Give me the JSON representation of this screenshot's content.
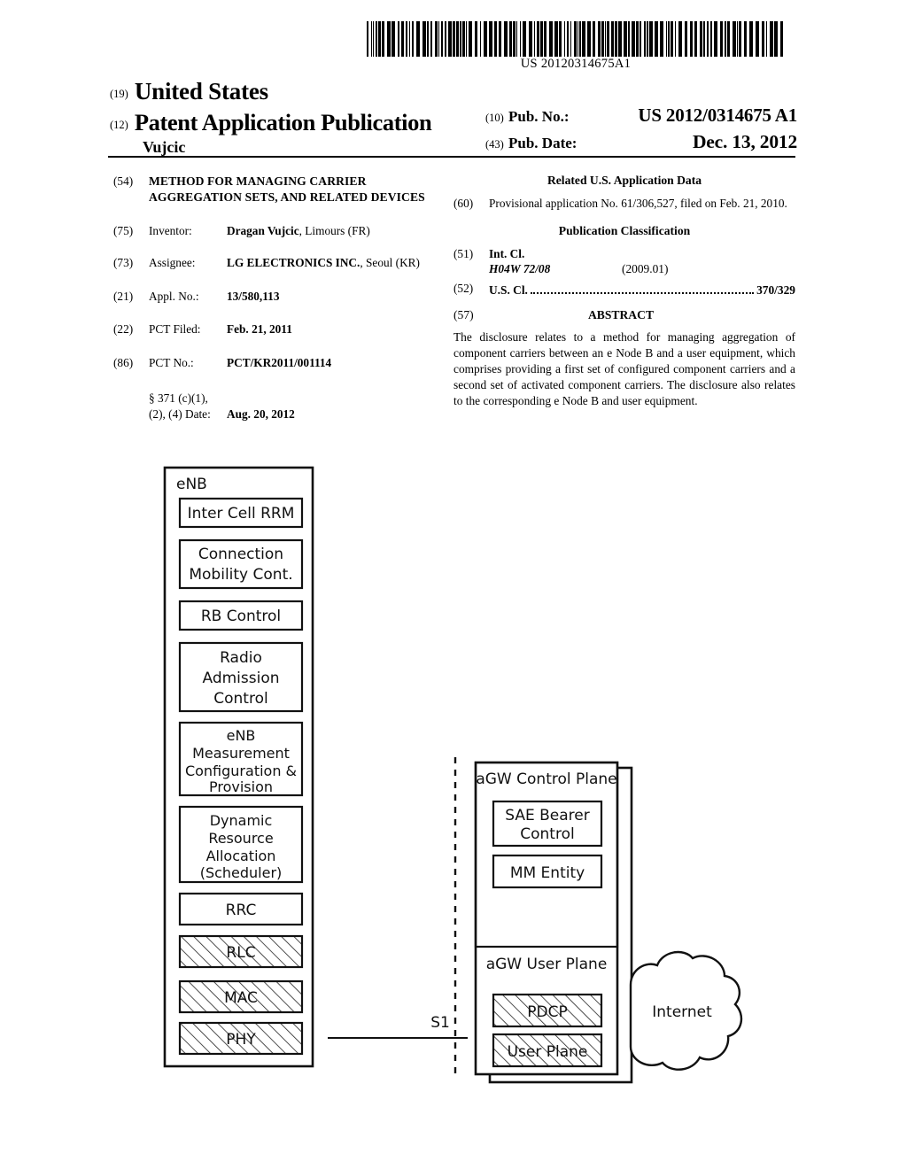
{
  "header": {
    "barcode_number": "US 20120314675A1",
    "tag_19": "(19)",
    "country": "United States",
    "tag_12": "(12)",
    "doc_type": "Patent Application Publication",
    "inventor_surname": "Vujcic",
    "tag_10": "(10)",
    "pub_no_label": "Pub. No.:",
    "pub_no_value": "US 2012/0314675 A1",
    "tag_43": "(43)",
    "pub_date_label": "Pub. Date:",
    "pub_date_value": "Dec. 13, 2012"
  },
  "left_column": {
    "title_tag": "(54)",
    "title": "METHOD FOR MANAGING CARRIER AGGREGATION SETS, AND RELATED DEVICES",
    "rows": [
      {
        "tag": "(75)",
        "label": "Inventor:",
        "bold_part": "Dragan Vujcic",
        "rest": ", Limours (FR)"
      },
      {
        "tag": "(73)",
        "label": "Assignee:",
        "bold_part": "LG ELECTRONICS INC.",
        "rest": ", Seoul (KR)"
      },
      {
        "tag": "(21)",
        "label": "Appl. No.:",
        "bold_part": "13/580,113",
        "rest": ""
      },
      {
        "tag": "(22)",
        "label": "PCT Filed:",
        "bold_part": "Feb. 21, 2011",
        "rest": ""
      },
      {
        "tag": "(86)",
        "label": "PCT No.:",
        "bold_part": "PCT/KR2011/001114",
        "rest": ""
      }
    ],
    "section371_line1": "§ 371 (c)(1),",
    "section371_line2": "(2), (4) Date:",
    "section371_date": "Aug. 20, 2012"
  },
  "right_column": {
    "related_head": "Related U.S. Application Data",
    "related_tag": "(60)",
    "related_text": "Provisional application No. 61/306,527, filed on Feb. 21, 2010.",
    "classification_head": "Publication Classification",
    "intcl_tag": "(51)",
    "intcl_label": "Int. Cl.",
    "intcl_code": "H04W 72/08",
    "intcl_version": "(2009.01)",
    "uscl_tag": "(52)",
    "uscl_label": "U.S. Cl.",
    "uscl_value": "370/329",
    "abstract_tag": "(57)",
    "abstract_head": "ABSTRACT",
    "abstract_text": "The disclosure relates to a method for managing aggregation of component carriers between an e Node B and a user equipment, which comprises providing a first set of configured component carriers and a second set of activated component carriers. The disclosure also relates to the corresponding e Node B and user equipment."
  },
  "figure": {
    "enb_label": "eNB",
    "enb_blocks": [
      {
        "label": "Inter Cell RRM",
        "hatched": false
      },
      {
        "label": "Connection\nMobility Cont.",
        "hatched": false
      },
      {
        "label": "RB Control",
        "hatched": false
      },
      {
        "label": "Radio\nAdmission\nControl",
        "hatched": false
      },
      {
        "label": "eNB\nMeasurement\nConfiguration &\nProvision",
        "hatched": false
      },
      {
        "label": "Dynamic\nResource\nAllocation\n(Scheduler)",
        "hatched": false
      },
      {
        "label": "RRC",
        "hatched": false
      },
      {
        "label": "RLC",
        "hatched": true
      },
      {
        "label": "MAC",
        "hatched": true
      },
      {
        "label": "PHY",
        "hatched": true
      }
    ],
    "interface_label": "S1",
    "agw_control_plane_label": "aGW Control Plane",
    "agw_control_blocks": [
      {
        "label": "SAE Bearer\nControl",
        "hatched": false
      },
      {
        "label": "MM Entity",
        "hatched": false
      }
    ],
    "agw_user_plane_label": "aGW User Plane",
    "agw_user_blocks": [
      {
        "label": "PDCP",
        "hatched": true
      },
      {
        "label": "User Plane",
        "hatched": true
      }
    ],
    "internet_label": "Internet"
  }
}
